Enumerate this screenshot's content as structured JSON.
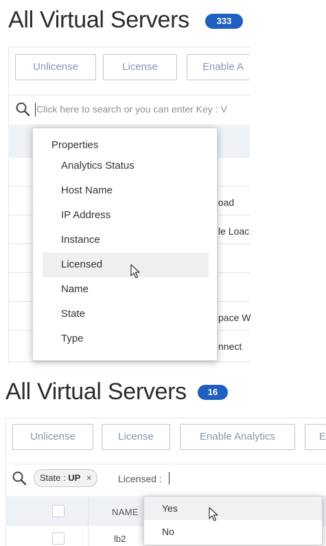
{
  "top": {
    "title": "All Virtual Servers",
    "count": "333",
    "buttons": [
      "Unlicense",
      "License",
      "Enable A"
    ],
    "search_placeholder": "Click here to search or you can enter Key : V",
    "row_fragments": [
      "Load",
      "le Loac",
      "pace W",
      "nnect"
    ]
  },
  "dropdown": {
    "header": "Properties",
    "items": [
      "Analytics Status",
      "Host Name",
      "IP Address",
      "Instance",
      "Licensed",
      "Name",
      "State",
      "Type"
    ],
    "hovered_index": 4
  },
  "bottom": {
    "title": "All Virtual Servers",
    "count": "16",
    "buttons": [
      "Unlicense",
      "License",
      "Enable Analytics",
      "E"
    ],
    "chip": {
      "key": "State : ",
      "value": "UP",
      "close": "×"
    },
    "search_text": "Licensed :",
    "column_name": "NAME",
    "row_name": "lb2"
  },
  "value_dropdown": {
    "items": [
      "Yes",
      "No"
    ],
    "hovered_index": 0
  },
  "colors": {
    "badge": "#1f5fbf",
    "button_border": "#b7c6da",
    "button_text": "#8596ad"
  }
}
